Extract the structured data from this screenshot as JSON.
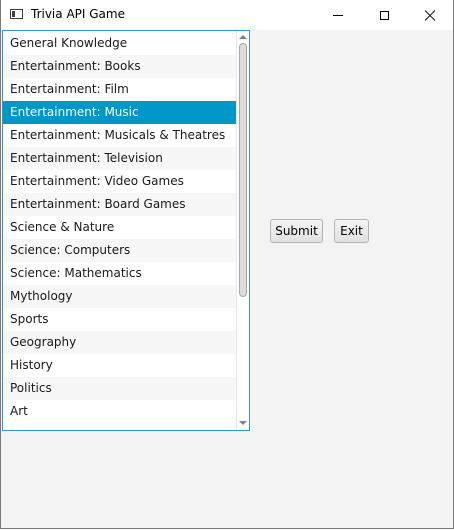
{
  "window": {
    "title": "Trivia API Game",
    "icon": "app-window-icon",
    "controls": [
      "minimize-icon",
      "maximize-icon",
      "close-icon"
    ]
  },
  "categories": {
    "items": [
      "General Knowledge",
      "Entertainment: Books",
      "Entertainment: Film",
      "Entertainment: Music",
      "Entertainment: Musicals & Theatres",
      "Entertainment: Television",
      "Entertainment: Video Games",
      "Entertainment: Board Games",
      "Science & Nature",
      "Science: Computers",
      "Science: Mathematics",
      "Mythology",
      "Sports",
      "Geography",
      "History",
      "Politics",
      "Art"
    ],
    "selected": "Entertainment: Music",
    "selection_color": "#0096c9",
    "border_color": "#3396d0"
  },
  "buttons": {
    "submit_label": "Submit",
    "exit_label": "Exit"
  }
}
